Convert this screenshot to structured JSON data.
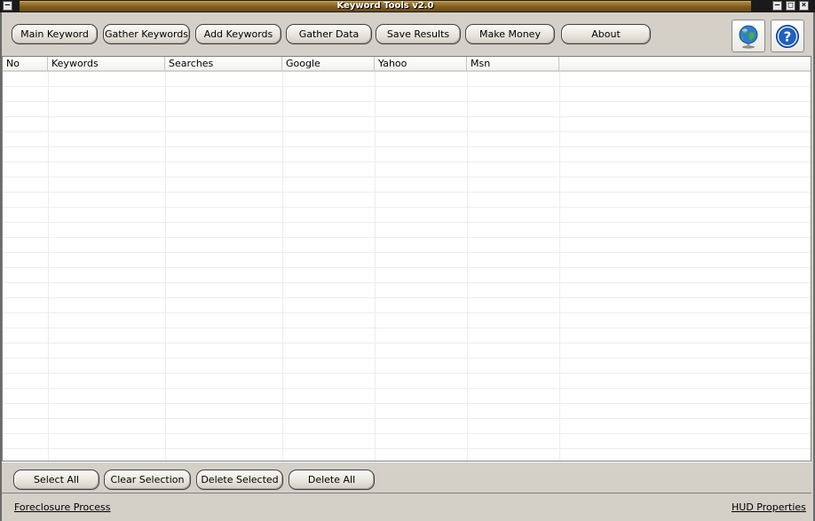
{
  "window": {
    "title": "Keyword Tools v2.0",
    "sysmenu_glyph": "–",
    "min_glyph": "–",
    "max_glyph": "□",
    "close_glyph": "×"
  },
  "toolbar": {
    "buttons": [
      {
        "label": "Main Keyword"
      },
      {
        "label": "Gather Keywords"
      },
      {
        "label": "Add Keywords"
      },
      {
        "label": "Gather Data"
      },
      {
        "label": "Save Results"
      },
      {
        "label": "Make Money"
      },
      {
        "label": "About"
      }
    ],
    "icons": [
      {
        "name": "globe-icon"
      },
      {
        "name": "help-icon",
        "glyph": "?"
      }
    ]
  },
  "grid": {
    "columns": [
      "No",
      "Keywords",
      "Searches",
      "Google",
      "Yahoo",
      "Msn"
    ],
    "rows": []
  },
  "actions": {
    "buttons": [
      {
        "label": "Select All"
      },
      {
        "label": "Clear Selection"
      },
      {
        "label": "Delete Selected"
      },
      {
        "label": "Delete All"
      }
    ]
  },
  "footer": {
    "left_link": "Foreclosure Process",
    "right_link": "HUD Properties"
  },
  "colors": {
    "title_gold": "#7d5b1f",
    "face": "#d4d0c8",
    "help_blue": "#1f5fbf"
  }
}
